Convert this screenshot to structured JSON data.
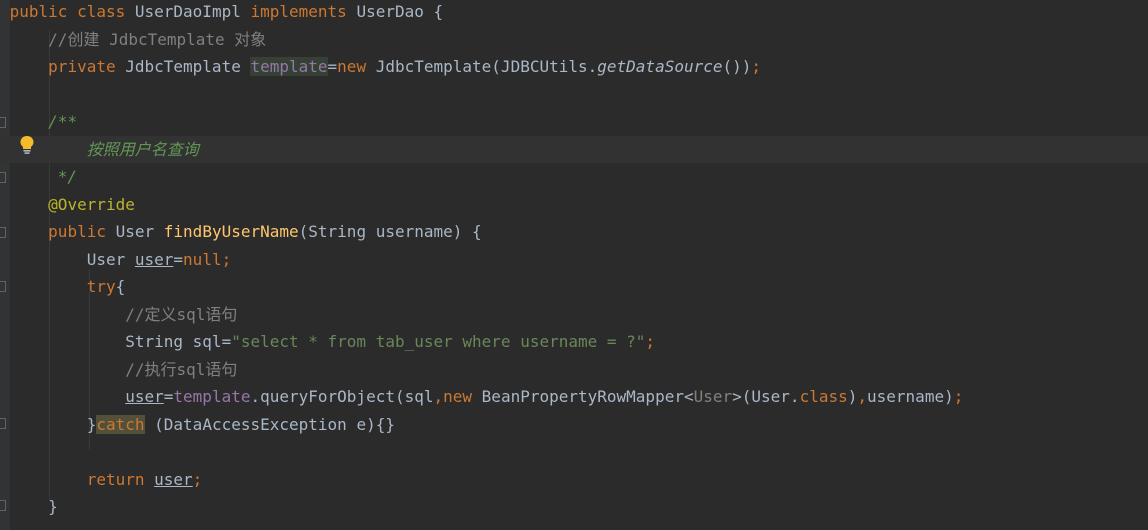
{
  "lines": [
    {
      "tokens": [
        {
          "t": "public ",
          "c": "kw"
        },
        {
          "t": "class ",
          "c": "kw"
        },
        {
          "t": "UserDaoImpl ",
          "c": "cls"
        },
        {
          "t": "implements ",
          "c": "kw"
        },
        {
          "t": "UserDao {",
          "c": "cls"
        }
      ]
    },
    {
      "indent": "    ",
      "tokens": [
        {
          "t": "//创建 JdbcTemplate 对象",
          "c": "cmt"
        }
      ]
    },
    {
      "indent": "    ",
      "tokens": [
        {
          "t": "private ",
          "c": "kw"
        },
        {
          "t": "JdbcTemplate ",
          "c": "cls"
        },
        {
          "t": "template",
          "c": "fld hl"
        },
        {
          "t": "=",
          "c": "cls"
        },
        {
          "t": "new ",
          "c": "kw"
        },
        {
          "t": "JdbcTemplate(JDBCUtils.",
          "c": "cls"
        },
        {
          "t": "getDataSource",
          "c": "cls ital"
        },
        {
          "t": "())",
          "c": "cls"
        },
        {
          "t": ";",
          "c": "kw"
        }
      ]
    },
    {
      "indent": "",
      "tokens": []
    },
    {
      "indent": "    ",
      "tokens": [
        {
          "t": "/**",
          "c": "doc"
        }
      ]
    },
    {
      "indent": "        ",
      "caret": true,
      "tokens": [
        {
          "t": "按照用户名查询",
          "c": "doc"
        }
      ]
    },
    {
      "indent": "     ",
      "tokens": [
        {
          "t": "*/",
          "c": "doc"
        }
      ]
    },
    {
      "indent": "    ",
      "tokens": [
        {
          "t": "@Override",
          "c": "ann"
        }
      ]
    },
    {
      "indent": "    ",
      "tokens": [
        {
          "t": "public ",
          "c": "kw"
        },
        {
          "t": "User ",
          "c": "cls"
        },
        {
          "t": "findByUserName",
          "c": "fn"
        },
        {
          "t": "(String username) {",
          "c": "cls"
        }
      ]
    },
    {
      "indent": "        ",
      "tokens": [
        {
          "t": "User ",
          "c": "cls"
        },
        {
          "t": "user",
          "c": "cls ul"
        },
        {
          "t": "=",
          "c": "cls"
        },
        {
          "t": "null",
          "c": "kw"
        },
        {
          "t": ";",
          "c": "kw"
        }
      ]
    },
    {
      "indent": "        ",
      "tokens": [
        {
          "t": "try",
          "c": "kw"
        },
        {
          "t": "{",
          "c": "cls"
        }
      ]
    },
    {
      "indent": "            ",
      "tokens": [
        {
          "t": "//定义sql语句",
          "c": "cmt"
        }
      ]
    },
    {
      "indent": "            ",
      "tokens": [
        {
          "t": "String sql=",
          "c": "cls"
        },
        {
          "t": "\"select * from tab_user where username = ?\"",
          "c": "str"
        },
        {
          "t": ";",
          "c": "kw"
        }
      ]
    },
    {
      "indent": "            ",
      "tokens": [
        {
          "t": "//执行sql语句",
          "c": "cmt"
        }
      ]
    },
    {
      "indent": "            ",
      "tokens": [
        {
          "t": "user",
          "c": "cls ul"
        },
        {
          "t": "=",
          "c": "cls"
        },
        {
          "t": "template",
          "c": "fld"
        },
        {
          "t": ".queryForObject(sql",
          "c": "cls"
        },
        {
          "t": ",",
          "c": "kw"
        },
        {
          "t": "new ",
          "c": "kw"
        },
        {
          "t": "BeanPropertyRowMapper<",
          "c": "cls"
        },
        {
          "t": "User",
          "c": "typearg"
        },
        {
          "t": ">(User.",
          "c": "cls"
        },
        {
          "t": "class",
          "c": "kw"
        },
        {
          "t": ")",
          "c": "cls"
        },
        {
          "t": ",",
          "c": "kw"
        },
        {
          "t": "username)",
          "c": "cls"
        },
        {
          "t": ";",
          "c": "kw"
        }
      ]
    },
    {
      "indent": "        ",
      "tokens": [
        {
          "t": "}",
          "c": "cls"
        },
        {
          "t": "catch",
          "c": "kw hl2"
        },
        {
          "t": " (DataAccessException e){}",
          "c": "cls"
        }
      ]
    },
    {
      "indent": "",
      "tokens": []
    },
    {
      "indent": "        ",
      "tokens": [
        {
          "t": "return ",
          "c": "kw"
        },
        {
          "t": "user",
          "c": "cls ul"
        },
        {
          "t": ";",
          "c": "kw"
        }
      ]
    },
    {
      "indent": "    ",
      "tokens": [
        {
          "t": "}",
          "c": "cls"
        }
      ]
    }
  ],
  "icons": {
    "intention": "lightbulb-icon"
  }
}
